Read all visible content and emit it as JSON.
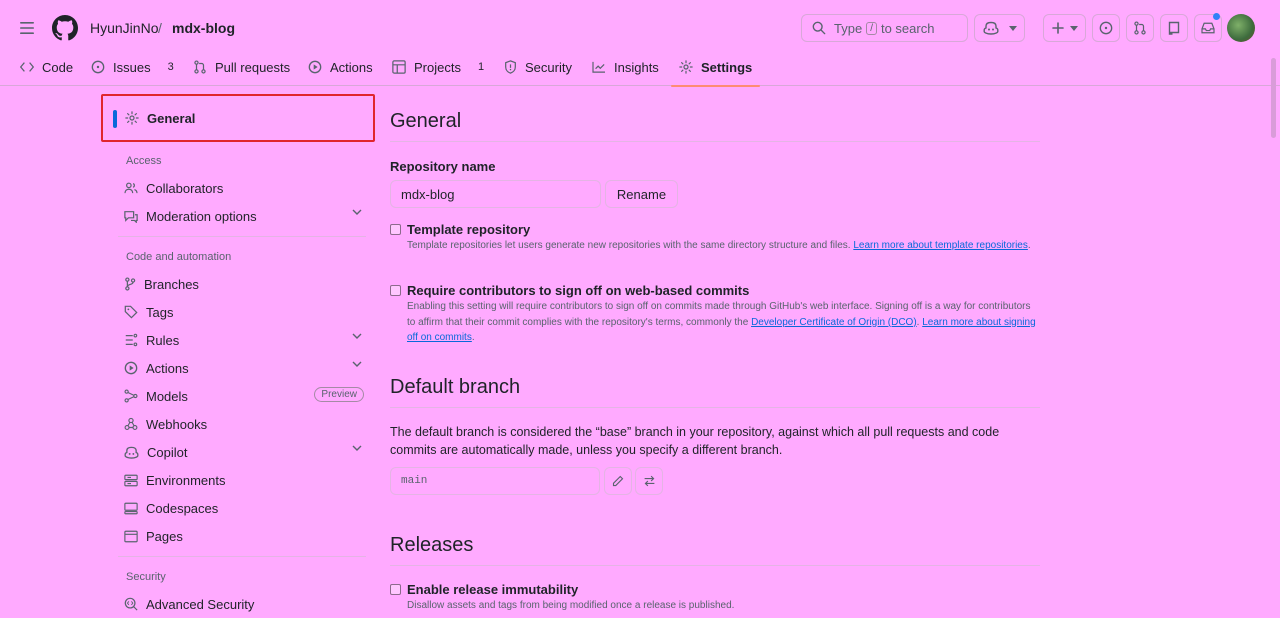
{
  "header": {
    "owner": "HyunJinNo",
    "separator": "/",
    "repo": "mdx-blog",
    "search": {
      "prefix": "Type",
      "key": "/",
      "suffix": "to search"
    },
    "icons": [
      "hamburger-icon",
      "github-logo-icon",
      "search-icon",
      "copilot-icon",
      "plus-icon",
      "issue-icon",
      "pull-request-icon",
      "repo-icon",
      "inbox-icon"
    ]
  },
  "tabs": [
    {
      "label": "Code",
      "count": "",
      "icon": "code-icon"
    },
    {
      "label": "Issues",
      "count": "3",
      "icon": "issue-icon"
    },
    {
      "label": "Pull requests",
      "count": "",
      "icon": "pull-request-icon"
    },
    {
      "label": "Actions",
      "count": "",
      "icon": "play-icon"
    },
    {
      "label": "Projects",
      "count": "1",
      "icon": "table-icon"
    },
    {
      "label": "Security",
      "count": "",
      "icon": "shield-icon"
    },
    {
      "label": "Insights",
      "count": "",
      "icon": "graph-icon"
    },
    {
      "label": "Settings",
      "count": "",
      "icon": "gear-icon",
      "selected": true
    }
  ],
  "sidebar": {
    "general": "General",
    "headings": {
      "access": "Access",
      "code_automation": "Code and automation",
      "security": "Security"
    },
    "items": {
      "collaborators": "Collaborators",
      "moderation": "Moderation options",
      "branches": "Branches",
      "tags": "Tags",
      "rules": "Rules",
      "actions": "Actions",
      "models": "Models",
      "models_badge": "Preview",
      "webhooks": "Webhooks",
      "copilot": "Copilot",
      "environments": "Environments",
      "codespaces": "Codespaces",
      "pages": "Pages",
      "advanced_security": "Advanced Security"
    }
  },
  "main": {
    "general_title": "General",
    "repo_name_label": "Repository name",
    "repo_name_value": "mdx-blog",
    "rename_button": "Rename",
    "template": {
      "title": "Template repository",
      "desc": "Template repositories let users generate new repositories with the same directory structure and files.",
      "link": "Learn more about template repositories",
      "suffix": "."
    },
    "signoff": {
      "title": "Require contributors to sign off on web-based commits",
      "desc": "Enabling this setting will require contributors to sign off on commits made through GitHub's web interface. Signing off is a way for contributors to affirm that their commit complies with the repository's terms, commonly the",
      "link1": "Developer Certificate of Origin (DCO)",
      "mid": ".",
      "link2": "Learn more about signing off on commits",
      "suffix": "."
    },
    "default_branch_title": "Default branch",
    "default_branch_desc": "The default branch is considered the “base” branch in your repository, against which all pull requests and code commits are automatically made, unless you specify a different branch.",
    "default_branch_value": "main",
    "releases_title": "Releases",
    "immutability": {
      "title": "Enable release immutability",
      "desc": "Disallow assets and tags from being modified once a release is published."
    }
  }
}
